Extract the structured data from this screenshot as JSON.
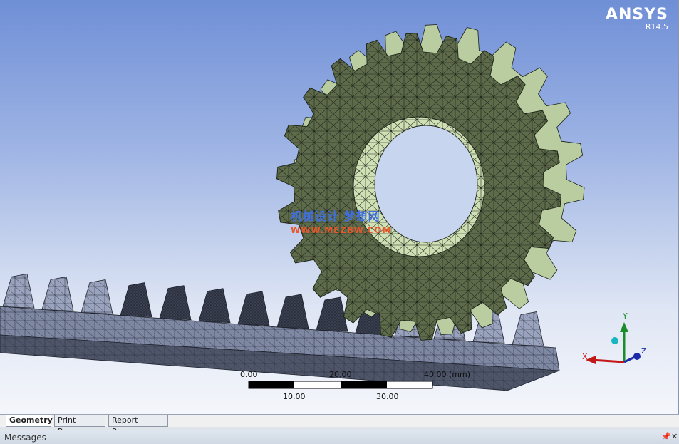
{
  "brand": {
    "name": "ANSYS",
    "version": "R14.5"
  },
  "watermark": {
    "cn": "机械设计 梦想网",
    "url": "WWW.MEZBW.COM"
  },
  "scale_bar": {
    "top_labels": [
      "0.00",
      "20.00",
      "40.00 (mm)"
    ],
    "bottom_labels": [
      "10.00",
      "30.00"
    ]
  },
  "triad": {
    "x": "X",
    "y": "Y",
    "z": "Z"
  },
  "tabs": [
    {
      "label": "Geometry",
      "active": true
    },
    {
      "label": "Print Preview",
      "active": false
    },
    {
      "label": "Report Preview",
      "active": false
    }
  ],
  "messages": {
    "title": "Messages",
    "pin_icon": "pin-icon",
    "close_icon": "close-icon"
  },
  "colors": {
    "gear_face": "#5e6b4a",
    "gear_light": "#cfe0b4",
    "rack": "#8e98b5",
    "mesh_line": "#1c2218"
  }
}
